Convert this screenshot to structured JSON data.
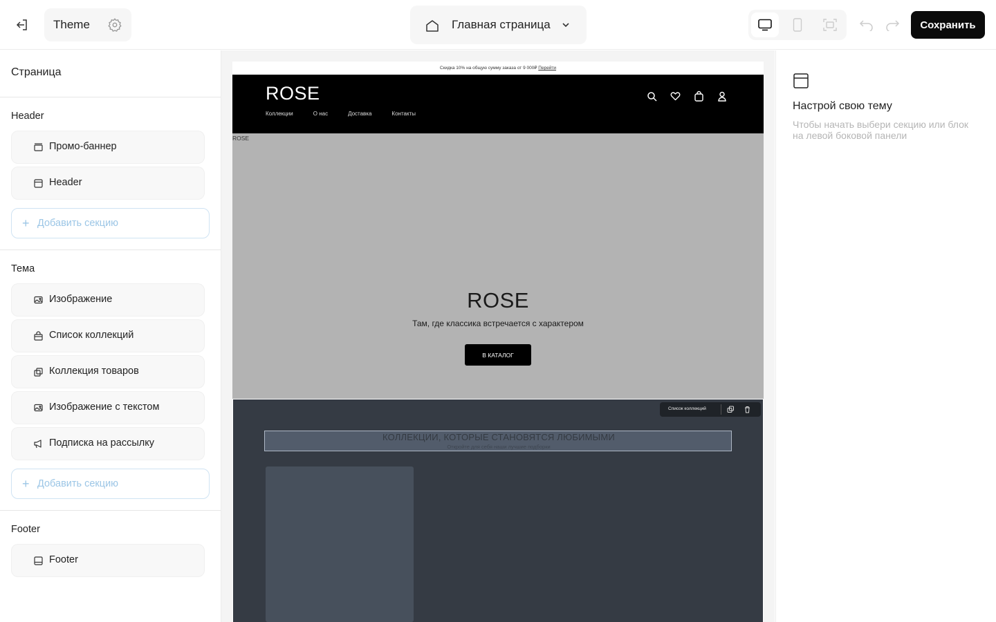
{
  "topbar": {
    "theme_label": "Theme",
    "page_label": "Главная страница",
    "save_label": "Сохранить"
  },
  "sidebar": {
    "title": "Страница",
    "groups": [
      {
        "title": "Header",
        "items": [
          {
            "label": "Промо-баннер",
            "icon": "banner-icon"
          },
          {
            "label": "Header",
            "icon": "header-icon"
          }
        ],
        "add_label": "Добавить секцию"
      },
      {
        "title": "Тема",
        "items": [
          {
            "label": "Изображение",
            "icon": "image-icon"
          },
          {
            "label": "Список коллекций",
            "icon": "bag-icon"
          },
          {
            "label": "Коллекция товаров",
            "icon": "copy-icon"
          },
          {
            "label": "Изображение с текстом",
            "icon": "image-icon"
          },
          {
            "label": "Подписка на рассылку",
            "icon": "megaphone-icon"
          }
        ],
        "add_label": "Добавить секцию"
      },
      {
        "title": "Footer",
        "items": [
          {
            "label": "Footer",
            "icon": "footer-icon"
          }
        ]
      }
    ]
  },
  "preview": {
    "promo_text": "Скидка 10% на общую сумму заказа от 9 000₽",
    "promo_link": "Перейти",
    "logo": "ROSE",
    "nav": [
      "Коллекции",
      "О нас",
      "Доставка",
      "Контакты"
    ],
    "hero_alt": "ROSE",
    "hero_title": "ROSE",
    "hero_subtitle": "Там, где классика встречается с характером",
    "hero_cta": "В КАТАЛОГ",
    "collections_toolbar_label": "Список коллекций",
    "collections_heading": "КОЛЛЕКЦИИ, КОТОРЫЕ СТАНОВЯТСЯ ЛЮБИМЫМИ",
    "collections_subheading": "Откройте для себя наши лучшие подборки"
  },
  "right_panel": {
    "title": "Настрой свою тему",
    "description": "Чтобы начать выбери секцию или блок на левой боковой панели"
  },
  "colors": {
    "accent": "#0b0b0b",
    "add_section": "#9cc6e6",
    "hero_bg": "#b3b3b3",
    "collections_bg": "#353b44"
  }
}
